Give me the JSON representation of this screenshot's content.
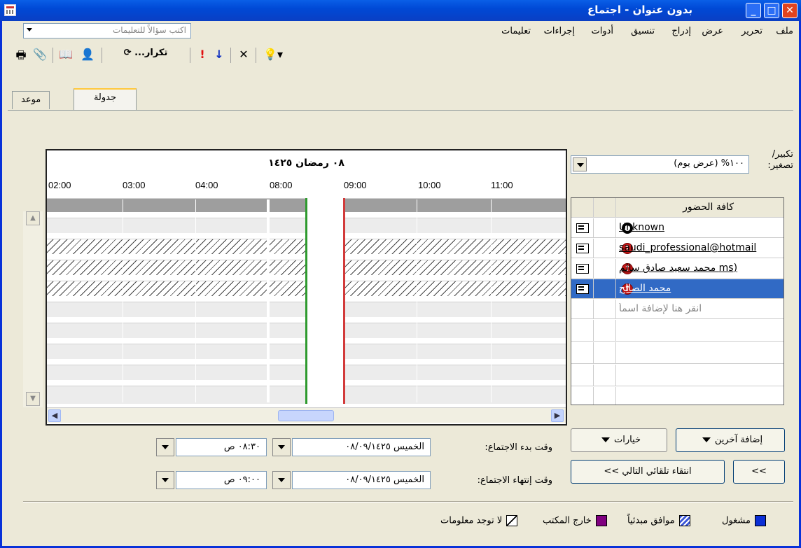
{
  "window": {
    "title": "بدون عنوان - اجتماع"
  },
  "menu": {
    "items": [
      "ملف",
      "تحرير",
      "عرض",
      "إدراج",
      "تنسيق",
      "أدوات",
      "إجراءات",
      "تعليمات"
    ],
    "help_placeholder": "اكتب سؤالاً للتعليمات"
  },
  "toolbar": {
    "recurrence_label": "تكرار..."
  },
  "tabs": {
    "appointment": "موعد",
    "scheduling": "جدولة"
  },
  "zoom": {
    "label": "تكبير/ تصغير:",
    "value": "١٠٠% (عرض يوم)"
  },
  "grid": {
    "date_header": "٠٨ رمضان ١٤٢٥",
    "hours": [
      "02:00",
      "03:00",
      "04:00",
      "08:00",
      "09:00",
      "10:00",
      "11:00"
    ]
  },
  "attendees": {
    "header": "كافة الحضور",
    "rows": [
      {
        "name": "Unknown",
        "status": "busy-unknown"
      },
      {
        "name": "saudi_professional@hotmail",
        "status": "required"
      },
      {
        "name": "(ms محمد سعيد صادق سالم",
        "status": "required"
      },
      {
        "name": "محمد الصالح",
        "status": "required",
        "selected": true
      }
    ],
    "add_prompt": "انقر هنا لإضافة اسماً"
  },
  "buttons": {
    "add_others": "إضافة آخرين",
    "options": "خيارات",
    "autopick_next": "انتقاء تلقائي التالي >>",
    "prev": "<<"
  },
  "meeting": {
    "start_label": "وقت بدء الاجتماع:",
    "start_date": "الخميس ٠٨/٠٩/١٤٢٥",
    "start_time": "٠٨:٣٠ ص",
    "end_label": "وقت إنتهاء الاجتماع:",
    "end_date": "الخميس ٠٨/٠٩/١٤٢٥",
    "end_time": "٠٩:٠٠ ص"
  },
  "legend": {
    "busy": "مشغول",
    "tentative": "موافق مبدئياً",
    "out_of_office": "خارج المكتب",
    "no_info": "لا توجد معلومات"
  },
  "colors": {
    "busy": "#0b2fd6",
    "tentative": "#3a55d8",
    "out_of_office": "#800080",
    "selection": "#316ac5"
  }
}
